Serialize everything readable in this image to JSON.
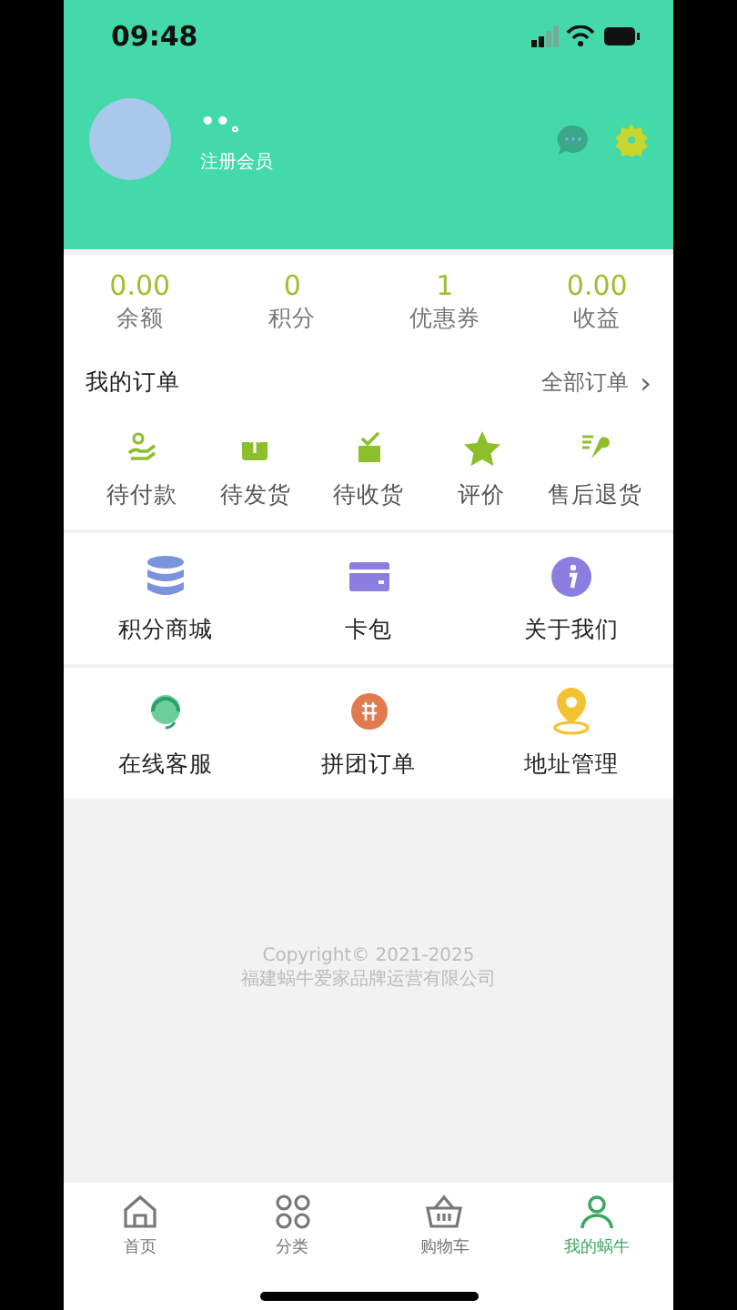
{
  "status_bar": {
    "time": "09:48"
  },
  "profile": {
    "name": "••。",
    "role": "注册会员"
  },
  "stats": [
    {
      "value": "0.00",
      "label": "余额"
    },
    {
      "value": "0",
      "label": "积分"
    },
    {
      "value": "1",
      "label": "优惠券"
    },
    {
      "value": "0.00",
      "label": "收益"
    }
  ],
  "orders": {
    "title": "我的订单",
    "all_link": "全部订单",
    "chevron": "›",
    "items": [
      "待付款",
      "待发货",
      "待收货",
      "评价",
      "售后退货"
    ]
  },
  "menu_rows": [
    [
      "积分商城",
      "卡包",
      "关于我们"
    ],
    [
      "在线客服",
      "拼团订单",
      "地址管理"
    ]
  ],
  "footer": {
    "copyright": "Copyright© 2021-2025",
    "company": "福建蜗牛爱家品牌运营有限公司"
  },
  "tab_bar": [
    {
      "label": "首页",
      "selected": false
    },
    {
      "label": "分类",
      "selected": false
    },
    {
      "label": "购物车",
      "selected": false
    },
    {
      "label": "我的蜗牛",
      "selected": true
    }
  ]
}
